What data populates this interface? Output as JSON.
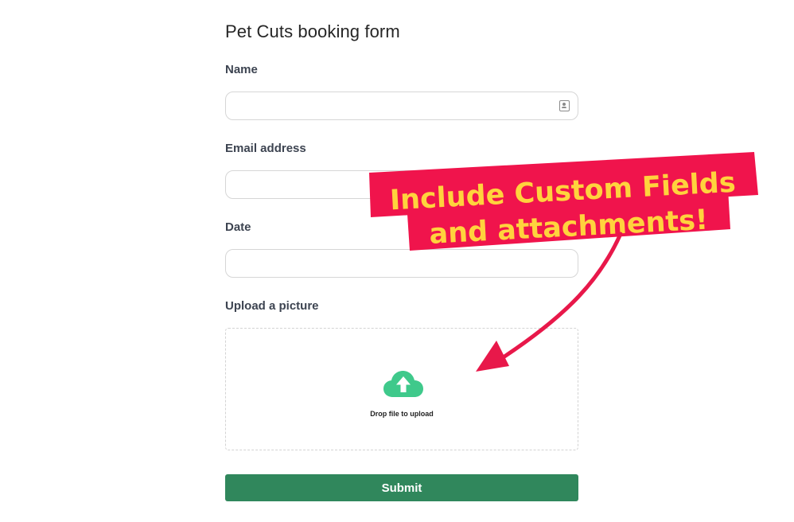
{
  "form": {
    "title": "Pet Cuts booking form",
    "fields": [
      {
        "label": "Name",
        "value": "",
        "placeholder": ""
      },
      {
        "label": "Email address",
        "value": "",
        "placeholder": ""
      },
      {
        "label": "Date",
        "value": "",
        "placeholder": ""
      }
    ],
    "upload": {
      "label": "Upload a picture",
      "dropzone_text": "Drop file to upload",
      "icon": "cloud-upload-icon",
      "icon_color": "#3fc98b"
    },
    "submit_label": "Submit",
    "submit_color": "#30875c"
  },
  "promo": {
    "line1": "Include Custom  Fields",
    "line2": "and attachments!",
    "background_color": "#f0144c",
    "text_color": "#ffd33d",
    "arrow_color": "#e8184a"
  }
}
